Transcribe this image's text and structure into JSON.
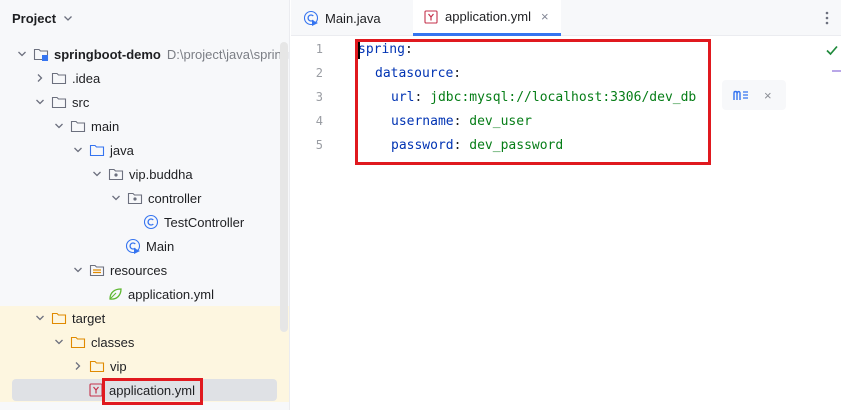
{
  "project": {
    "title": "Project",
    "tree": [
      {
        "label": "springboot-demo",
        "extra": "D:\\project\\java\\springb",
        "icon": "module-folder-icon"
      },
      {
        "label": ".idea",
        "icon": "folder-icon"
      },
      {
        "label": "src",
        "icon": "folder-icon"
      },
      {
        "label": "main",
        "icon": "folder-icon"
      },
      {
        "label": "java",
        "icon": "source-folder-icon"
      },
      {
        "label": "vip.buddha",
        "icon": "package-icon"
      },
      {
        "label": "controller",
        "icon": "package-icon"
      },
      {
        "label": "TestController",
        "icon": "class-icon"
      },
      {
        "label": "Main",
        "icon": "main-class-icon"
      },
      {
        "label": "resources",
        "icon": "resources-folder-icon"
      },
      {
        "label": "application.yml",
        "icon": "spring-yml-icon"
      },
      {
        "label": "target",
        "icon": "excluded-folder-icon"
      },
      {
        "label": "classes",
        "icon": "excluded-folder-icon"
      },
      {
        "label": "vip",
        "icon": "excluded-folder-icon"
      },
      {
        "label": "application.yml",
        "icon": "yaml-file-icon"
      }
    ]
  },
  "editor": {
    "tabs": [
      {
        "label": "Main.java",
        "icon": "main-class-icon"
      },
      {
        "label": "application.yml",
        "icon": "yaml-file-icon",
        "close": "×"
      }
    ],
    "line_numbers": [
      "1",
      "2",
      "3",
      "4",
      "5"
    ],
    "code": {
      "l1_key": "spring",
      "l1_colon": ":",
      "l2_key": "datasource",
      "l2_colon": ":",
      "l3_key": "url",
      "l3_colon": ": ",
      "l3_val": "jdbc:mysql://localhost:3306/dev_db",
      "l4_key": "username",
      "l4_colon": ": ",
      "l4_val": "dev_user",
      "l5_key": "password",
      "l5_colon": ": ",
      "l5_val": "dev_password"
    },
    "popup_close": "×"
  },
  "colors": {
    "accent": "#3574f0",
    "highlight_box": "#e0191f",
    "yaml_key": "#0033b3",
    "yaml_value": "#067d17"
  }
}
